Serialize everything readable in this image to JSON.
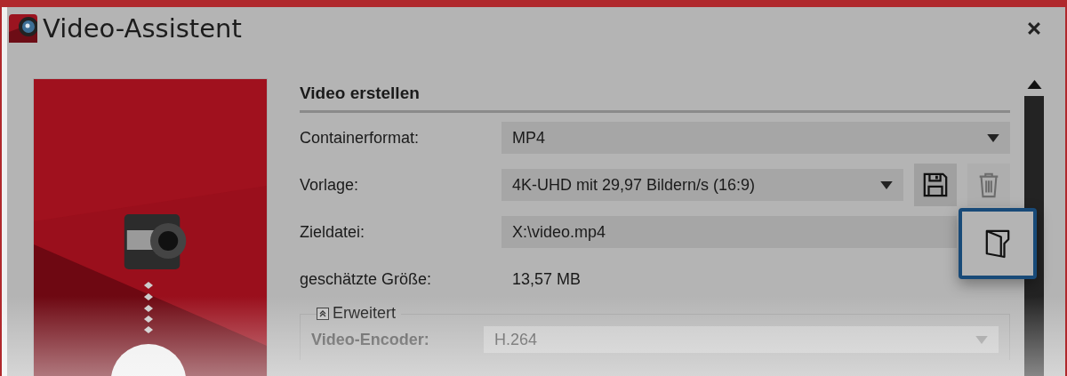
{
  "window": {
    "title": "Video-Assistent"
  },
  "section": {
    "title": "Video erstellen"
  },
  "rows": [
    {
      "kind": "select",
      "label": "Containerformat:",
      "value": "MP4"
    },
    {
      "kind": "select",
      "label": "Vorlage:",
      "value": "4K-UHD mit 29,97 Bildern/s (16:9)",
      "buttons": [
        {
          "kind": "save",
          "disabled": false,
          "highlighted": false
        },
        {
          "kind": "delete",
          "disabled": true,
          "highlighted": false
        }
      ]
    },
    {
      "kind": "text",
      "label": "Zieldatei:",
      "value": "X:\\video.mp4",
      "buttons": [
        {
          "kind": "folder",
          "disabled": false,
          "highlighted": true
        }
      ]
    },
    {
      "kind": "readout",
      "label": "geschätzte Größe:",
      "value": "13,57 MB"
    }
  ],
  "advanced": {
    "title": "Erweitert",
    "expanded": true,
    "rows": [
      {
        "kind": "select",
        "label": "Video-Encoder:",
        "value": "H.264"
      }
    ]
  }
}
